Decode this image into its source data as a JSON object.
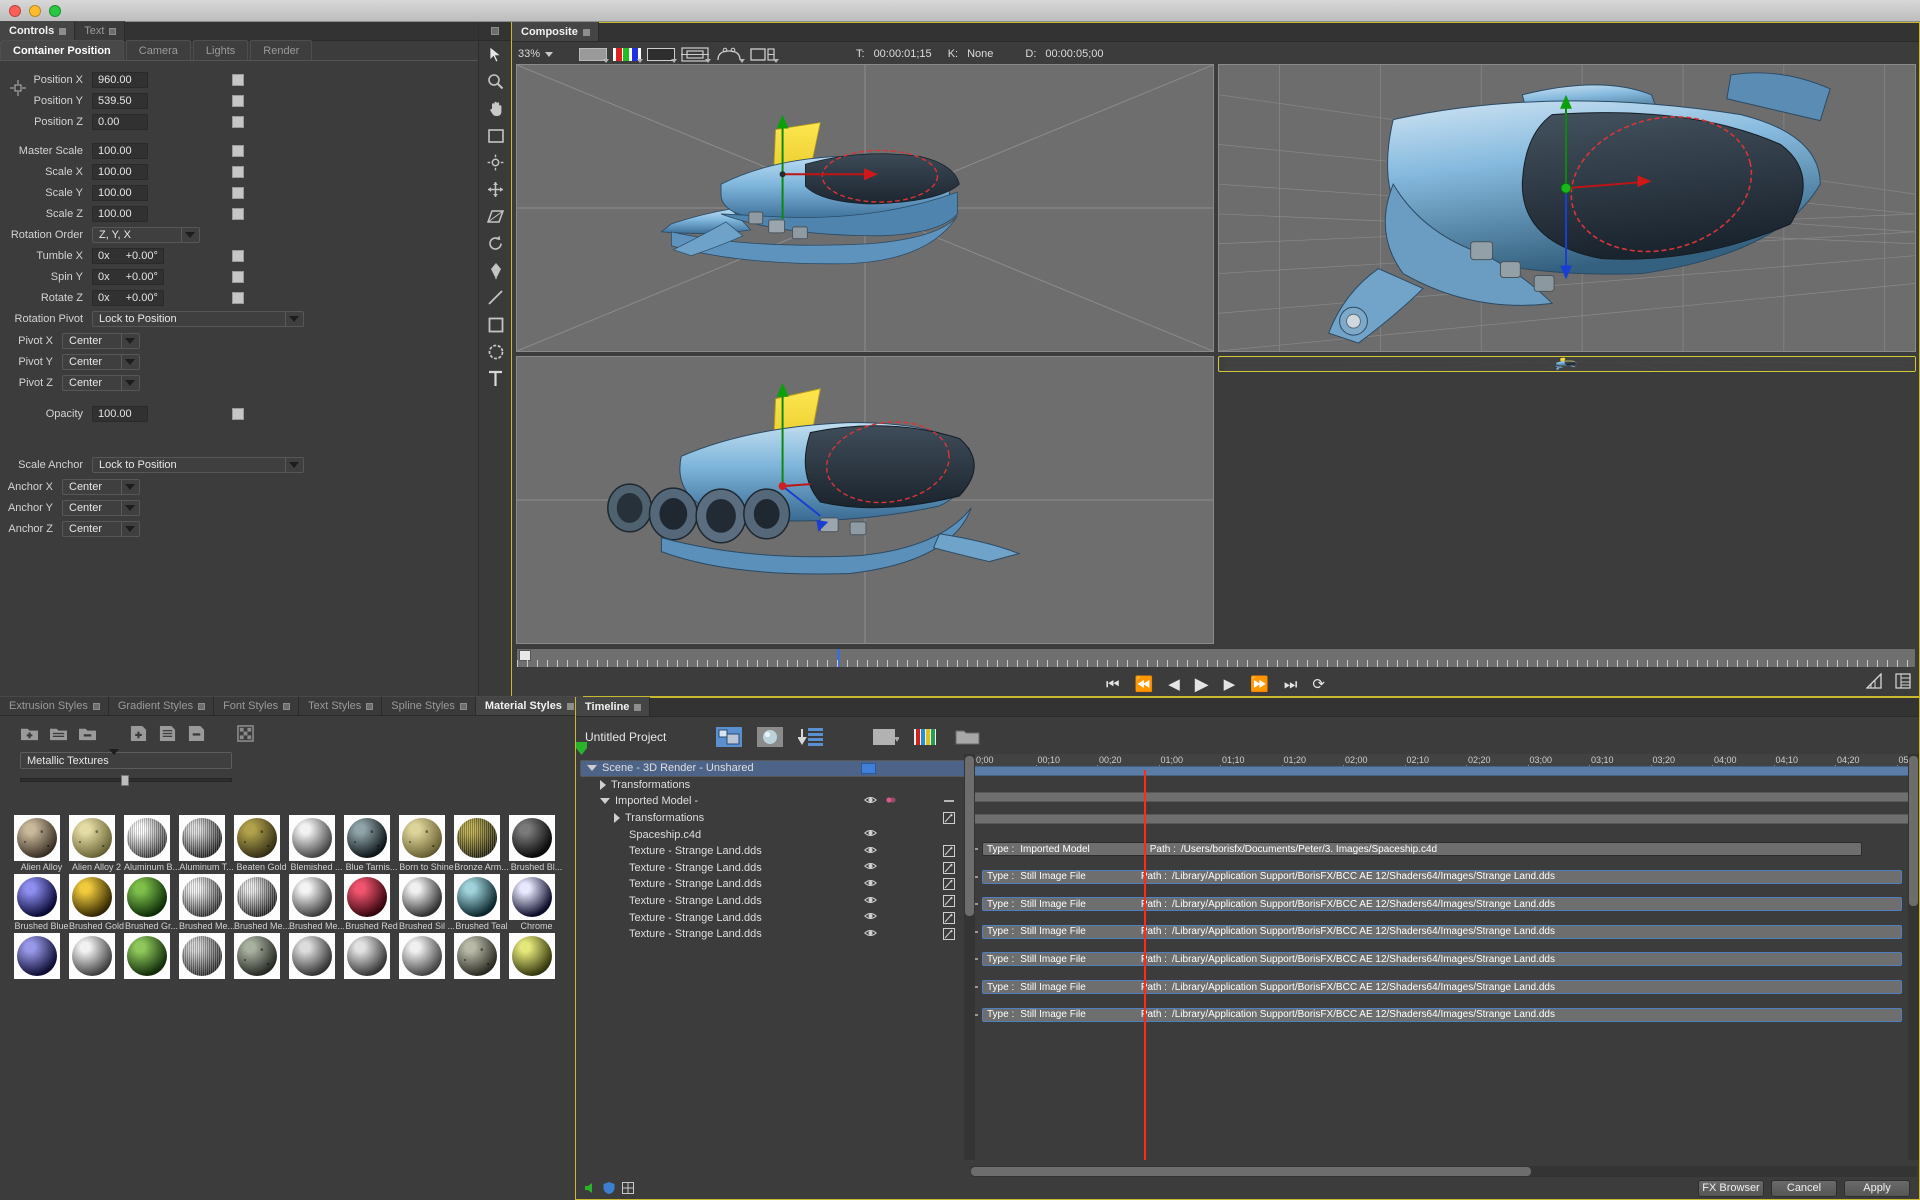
{
  "window": {
    "title": ""
  },
  "controls": {
    "tabs": [
      {
        "label": "Controls",
        "active": true
      },
      {
        "label": "Text",
        "active": false
      }
    ],
    "subtabs": [
      {
        "label": "Container Position",
        "active": true
      },
      {
        "label": "Camera",
        "active": false
      },
      {
        "label": "Lights",
        "active": false
      },
      {
        "label": "Render",
        "active": false
      }
    ],
    "params": [
      {
        "label": "Position X",
        "value": "960.00",
        "kind": "num"
      },
      {
        "label": "Position Y",
        "value": "539.50",
        "kind": "num"
      },
      {
        "label": "Position Z",
        "value": "0.00",
        "kind": "num"
      },
      {
        "label": "Master Scale",
        "value": "100.00",
        "kind": "num"
      },
      {
        "label": "Scale X",
        "value": "100.00",
        "kind": "num"
      },
      {
        "label": "Scale Y",
        "value": "100.00",
        "kind": "num"
      },
      {
        "label": "Scale Z",
        "value": "100.00",
        "kind": "num"
      }
    ],
    "rotation_order": {
      "label": "Rotation Order",
      "value": "Z, Y, X"
    },
    "angles": [
      {
        "label": "Tumble X",
        "rev": "0x",
        "deg": "+0.00°"
      },
      {
        "label": "Spin Y",
        "rev": "0x",
        "deg": "+0.00°"
      },
      {
        "label": "Rotate Z",
        "rev": "0x",
        "deg": "+0.00°"
      }
    ],
    "rotation_pivot": {
      "label": "Rotation Pivot",
      "value": "Lock to Position"
    },
    "pivots": [
      {
        "label": "Pivot X",
        "value": "Center"
      },
      {
        "label": "Pivot Y",
        "value": "Center"
      },
      {
        "label": "Pivot Z",
        "value": "Center"
      }
    ],
    "opacity": {
      "label": "Opacity",
      "value": "100.00"
    },
    "scale_anchor": {
      "label": "Scale Anchor",
      "value": "Lock to Position"
    },
    "anchors": [
      {
        "label": "Anchor X",
        "value": "Center"
      },
      {
        "label": "Anchor Y",
        "value": "Center"
      },
      {
        "label": "Anchor Z",
        "value": "Center"
      }
    ]
  },
  "toolstrip": {
    "tools": [
      "arrow-select-icon",
      "zoom-magnifier-icon",
      "pan-hand-icon",
      "rectangle-mask-icon",
      "light-sun-icon",
      "move-crosshair-icon",
      "perspective-corner-icon",
      "rotate-icon",
      "pen-icon",
      "line-icon",
      "rectangle-icon",
      "ellipse-icon",
      "text-icon"
    ]
  },
  "composite": {
    "tabs": [
      {
        "label": "Composite",
        "active": true
      }
    ],
    "zoom": "33%",
    "toolbar_icons": [
      "background-swatch-icon",
      "rgb-channels-icon",
      "alpha-matte-icon",
      "safe-areas-icon",
      "grid-overlay-icon",
      "split-view-icon"
    ],
    "time_label": "T:",
    "time_value": "00:00:01;15",
    "key_label": "K:",
    "key_value": "None",
    "duration_label": "D:",
    "duration_value": "00:00:05;00",
    "views": [
      {
        "name": "front-view",
        "selected": false
      },
      {
        "name": "right-view",
        "selected": false
      },
      {
        "name": "top-view",
        "selected": false
      },
      {
        "name": "perspective-view",
        "selected": true
      }
    ],
    "transport": [
      "go-to-start-button",
      "rewind-button",
      "step-back-button",
      "play-button",
      "step-forward-button",
      "fast-forward-button",
      "go-to-end-button",
      "loop-button"
    ],
    "right_icons": [
      "waveform-icon",
      "list-view-icon"
    ]
  },
  "styles": {
    "tabs": [
      {
        "label": "Extrusion Styles",
        "active": false
      },
      {
        "label": "Gradient Styles",
        "active": false
      },
      {
        "label": "Font Styles",
        "active": false
      },
      {
        "label": "Text Styles",
        "active": false
      },
      {
        "label": "Spline Styles",
        "active": false
      },
      {
        "label": "Material Styles",
        "active": true
      }
    ],
    "toolbar_icons": [
      "new-folder-icon",
      "open-folder-icon",
      "remove-folder-icon",
      "add-style-icon",
      "copy-style-icon",
      "delete-style-icon",
      "checker-preview-icon"
    ],
    "category": "Metallic Textures",
    "swatches": [
      {
        "name": "Alien Alloy",
        "c1": "#c9b89a",
        "c2": "#3e3428",
        "speck": true
      },
      {
        "name": "Alien Alloy 2",
        "c1": "#e4dba4",
        "c2": "#6f6a3a",
        "speck": true
      },
      {
        "name": "Aluminum B...",
        "c1": "#ffffff",
        "c2": "#4a4a4a",
        "brushed": true
      },
      {
        "name": "Aluminum T...",
        "c1": "#d9d9d9",
        "c2": "#2e2e2e",
        "brushed": true
      },
      {
        "name": "Beaten Gold",
        "c1": "#b0a14a",
        "c2": "#3a3318",
        "speck": true
      },
      {
        "name": "Blemished ...",
        "c1": "#f2f2f2",
        "c2": "#4b4b4b"
      },
      {
        "name": "Blue Tarnis...",
        "c1": "#8fa4a8",
        "c2": "#10181c",
        "speck": true
      },
      {
        "name": "Born to Shine",
        "c1": "#ddd49a",
        "c2": "#6d6436",
        "speck": true
      },
      {
        "name": "Bronze Arm...",
        "c1": "#b2a342",
        "c2": "#2d2a10",
        "brushed": true
      },
      {
        "name": "Brushed Bl...",
        "c1": "#7a7a7a",
        "c2": "#0b0b0b"
      },
      {
        "name": "Brushed Blue",
        "c1": "#8e8ef0",
        "c2": "#0c0c3a"
      },
      {
        "name": "Brushed Gold",
        "c1": "#f0ca3c",
        "c2": "#3a2c04"
      },
      {
        "name": "Brushed Gr...",
        "c1": "#7ebf4a",
        "c2": "#10310a"
      },
      {
        "name": "Brushed Me...",
        "c1": "#f2f2f2",
        "c2": "#3e3e3e",
        "brushed": true
      },
      {
        "name": "Brushed Me...",
        "c1": "#e8e8e8",
        "c2": "#2f2f2f",
        "brushed": true
      },
      {
        "name": "Brushed Me...",
        "c1": "#f4f4f4",
        "c2": "#434343"
      },
      {
        "name": "Brushed Red",
        "c1": "#f0546e",
        "c2": "#3a0610"
      },
      {
        "name": "Brushed Sil ...",
        "c1": "#f0f0f0",
        "c2": "#353535"
      },
      {
        "name": "Brushed Teal",
        "c1": "#9fd2da",
        "c2": "#0d2a30"
      },
      {
        "name": "Chrome",
        "c1": "#e8e8ff",
        "c2": "#0e0e2c"
      },
      {
        "name": "",
        "c1": "#9898e8",
        "c2": "#101038"
      },
      {
        "name": "",
        "c1": "#f2f2f2",
        "c2": "#454545"
      },
      {
        "name": "",
        "c1": "#8ec85a",
        "c2": "#14300c"
      },
      {
        "name": "",
        "c1": "#cfcfcf",
        "c2": "#3b3b3b",
        "brushed": true
      },
      {
        "name": "",
        "c1": "#a8b0a0",
        "c2": "#2a2e26",
        "speck": true
      },
      {
        "name": "",
        "c1": "#dcdcdc",
        "c2": "#383838"
      },
      {
        "name": "",
        "c1": "#e2e2e2",
        "c2": "#3a3a3a"
      },
      {
        "name": "",
        "c1": "#f0f0f0",
        "c2": "#4a4a4a"
      },
      {
        "name": "",
        "c1": "#b9b9a8",
        "c2": "#2e2e26",
        "speck": true
      },
      {
        "name": "",
        "c1": "#e4e87a",
        "c2": "#3a3c10"
      }
    ]
  },
  "timeline": {
    "tabs": [
      {
        "label": "Timeline",
        "active": true
      }
    ],
    "project_name": "Untitled Project",
    "toolbar_icons": [
      "layers-view-icon",
      "material-sphere-icon",
      "collapse-tracks-icon",
      "blank-swatch-icon",
      "color-bars-icon",
      "folder-icon"
    ],
    "tree": [
      {
        "label": "Scene - 3D Render - Unshared",
        "indent": 0,
        "disc": "open",
        "selected": true,
        "folder": true
      },
      {
        "label": "Transformations",
        "indent": 1,
        "disc": "closed",
        "selected": false
      },
      {
        "label": "Imported Model -",
        "indent": 1,
        "disc": "open",
        "selected": false,
        "eye": true,
        "eye2": true,
        "minus": true
      },
      {
        "label": "Transformations",
        "indent": 2,
        "disc": "closed",
        "selected": false,
        "sq": true
      },
      {
        "label": "Spaceship.c4d",
        "indent": 2,
        "disc": "none",
        "selected": false,
        "eye": true
      },
      {
        "label": "Texture - Strange Land.dds",
        "indent": 2,
        "disc": "none",
        "selected": false,
        "eye": true,
        "sq": true
      },
      {
        "label": "Texture - Strange Land.dds",
        "indent": 2,
        "disc": "none",
        "selected": false,
        "eye": true,
        "sq": true
      },
      {
        "label": "Texture - Strange Land.dds",
        "indent": 2,
        "disc": "none",
        "selected": false,
        "eye": true,
        "sq": true
      },
      {
        "label": "Texture - Strange Land.dds",
        "indent": 2,
        "disc": "none",
        "selected": false,
        "eye": true,
        "sq": true
      },
      {
        "label": "Texture - Strange Land.dds",
        "indent": 2,
        "disc": "none",
        "selected": false,
        "eye": true,
        "sq": true
      },
      {
        "label": "Texture - Strange Land.dds",
        "indent": 2,
        "disc": "none",
        "selected": false,
        "eye": true,
        "sq": true
      }
    ],
    "ruler_labels": [
      "0;00",
      "00;10",
      "00;20",
      "01;00",
      "01;10",
      "01;20",
      "02;00",
      "02;10",
      "02;20",
      "03;00",
      "03;10",
      "03;20",
      "04;00",
      "04;10",
      "04;20",
      "05"
    ],
    "clips": [
      {
        "type_label": "Type :",
        "type": "Imported Model",
        "path_label": "Path :",
        "path": "/Users/borisfx/Documents/Peter/3. Images/Spaceship.c4d",
        "kind": "model"
      },
      {
        "type_label": "Type :",
        "type": "Still Image File",
        "path_label": "Path :",
        "path": "/Library/Application Support/BorisFX/BCC AE 12/Shaders64/Images/Strange Land.dds",
        "kind": "image"
      },
      {
        "type_label": "Type :",
        "type": "Still Image File",
        "path_label": "Path :",
        "path": "/Library/Application Support/BorisFX/BCC AE 12/Shaders64/Images/Strange Land.dds",
        "kind": "image"
      },
      {
        "type_label": "Type :",
        "type": "Still Image File",
        "path_label": "Path :",
        "path": "/Library/Application Support/BorisFX/BCC AE 12/Shaders64/Images/Strange Land.dds",
        "kind": "image"
      },
      {
        "type_label": "Type :",
        "type": "Still Image File",
        "path_label": "Path :",
        "path": "/Library/Application Support/BorisFX/BCC AE 12/Shaders64/Images/Strange Land.dds",
        "kind": "image"
      },
      {
        "type_label": "Type :",
        "type": "Still Image File",
        "path_label": "Path :",
        "path": "/Library/Application Support/BorisFX/BCC AE 12/Shaders64/Images/Strange Land.dds",
        "kind": "image"
      },
      {
        "type_label": "Type :",
        "type": "Still Image File",
        "path_label": "Path :",
        "path": "/Library/Application Support/BorisFX/BCC AE 12/Shaders64/Images/Strange Land.dds",
        "kind": "image"
      }
    ],
    "buttons": {
      "fx_browser": "FX Browser",
      "cancel": "Cancel",
      "apply": "Apply"
    }
  }
}
